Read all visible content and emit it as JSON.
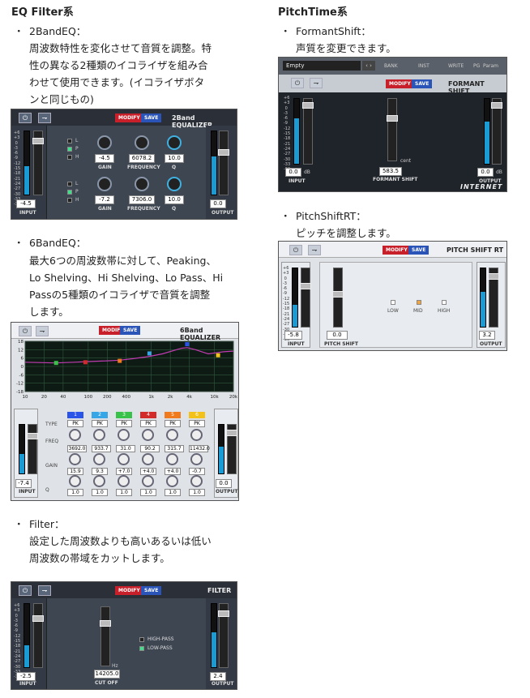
{
  "sections": {
    "eq": {
      "heading": "EQ Filter系",
      "items": [
        {
          "name": "2BandEQ：",
          "lines": [
            "周波数特性を変化させて音質を調整。特",
            "性の異なる2種類のイコライザを組み合",
            "わせて使用できます。(イコライザボタ",
            "ンと同じもの)"
          ]
        },
        {
          "name": "6BandEQ：",
          "lines": [
            "最大6つの周波数帯に対して、Peaking、",
            "Lo Shelving、Hi Shelving、Lo Pass、Hi",
            "Passの5種類のイコライザで音質を調整",
            "します。"
          ]
        },
        {
          "name": "Filter：",
          "lines": [
            "設定した周波数よりも高いあるいは低い",
            "周波数の帯域をカットします。"
          ]
        }
      ]
    },
    "pitch": {
      "heading": "PitchTime系",
      "items": [
        {
          "name": "FormantShift：",
          "lines": [
            "声質を変更できます。"
          ]
        },
        {
          "name": "PitchShiftRT：",
          "lines": [
            "ピッチを調整します。"
          ]
        }
      ]
    }
  },
  "common": {
    "modify": "MODIFY",
    "save": "SAVE",
    "input": "INPUT",
    "output": "OUTPUT",
    "power": "⏻",
    "route": "⇁",
    "db": "dB"
  },
  "band2": {
    "title": "2Band EQUALIZER",
    "in": "-4.5",
    "out": "0.0",
    "rows": [
      {
        "gain": "-4.5",
        "freq": "6078.2",
        "q": "10.0",
        "checks": [
          "L",
          "P",
          "H"
        ]
      },
      {
        "gain": "-7.2",
        "freq": "7306.0",
        "q": "10.0",
        "checks": [
          "L",
          "P",
          "H"
        ]
      }
    ],
    "gain_l": "GAIN",
    "freq_l": "FREQUENCY",
    "q_l": "Q",
    "hz": "Hz"
  },
  "band6": {
    "title": "6Band EQUALIZER",
    "in": "-7.4",
    "out": "0.0",
    "yticks": [
      "18",
      "12",
      "6",
      "0",
      "-6",
      "-12",
      "-18"
    ],
    "xticks": [
      "10",
      "20",
      "40",
      "100",
      "200",
      "400",
      "1k",
      "2k",
      "4k",
      "10k",
      "20k"
    ],
    "bands": [
      "1",
      "2",
      "3",
      "4",
      "5",
      "6"
    ],
    "band_colors": [
      "#2a54e8",
      "#37a6e6",
      "#39c24a",
      "#d32a2a",
      "#f07a1e",
      "#f2c21b"
    ],
    "type_l": "TYPE",
    "freq_l": "FREQ",
    "gain_l": "GAIN",
    "q_l": "Q",
    "types": [
      "PK",
      "PK",
      "PK",
      "PK",
      "PK",
      "PK"
    ],
    "freqs": [
      "3692.0",
      "933.7",
      "31.0",
      "90.2",
      "315.7",
      "11432.0"
    ],
    "gains": [
      "15.9",
      "9.3",
      "+7.0",
      "+4.0",
      "+4.0",
      "-0.7"
    ],
    "qs": [
      "1.0",
      "1.0",
      "1.0",
      "1.0",
      "1.0",
      "1.0"
    ]
  },
  "filter": {
    "title": "FILTER",
    "in": "-2.5",
    "out": "2.4",
    "cutoff": "14205.0",
    "cutoff_l": "CUT OFF",
    "hz": "Hz",
    "hp": "HIGH-PASS",
    "lp": "LOW-PASS"
  },
  "formant": {
    "preset": "Empty",
    "bank": "BANK",
    "inst": "INST",
    "write": "WRITE",
    "pg": "PG",
    "param": "Param",
    "title": "FORMANT SHIFT",
    "in": "0.0",
    "out": "0.0",
    "shift": "583.5",
    "cent": "cent",
    "shift_l": "FORMANT SHIFT",
    "logo": "INTERNET"
  },
  "pitchrt": {
    "title": "PITCH SHIFT RT",
    "in": "-5.8",
    "out": "3.2",
    "pitch": "0.0",
    "pitch_l": "PITCH SHIFT",
    "low": "LOW",
    "mid": "MID",
    "high": "HIGH"
  },
  "scale": "+6\n+3\n 0\n-3\n-6\n-9\n-12\n-15\n-18\n-21\n-24\n-27\n-30\n-33\n-36",
  "chart_data": {
    "type": "line",
    "x_scale": "log",
    "xlim": [
      10,
      20000
    ],
    "ylim": [
      -18,
      18
    ],
    "ylabel": "dB",
    "x": [
      10,
      30,
      60,
      100,
      200,
      315,
      500,
      900,
      1500,
      3000,
      3692,
      5000,
      8000,
      11432,
      14000,
      20000
    ],
    "series": [
      {
        "values": [
          3,
          2.5,
          3,
          3.5,
          4,
          4.5,
          5.5,
          7,
          9,
          13,
          13.5,
          12,
          9,
          10,
          10.5,
          11
        ]
      }
    ],
    "points": [
      {
        "x": 31,
        "y": 2.5
      },
      {
        "x": 90.2,
        "y": 3
      },
      {
        "x": 315.7,
        "y": 4
      },
      {
        "x": 933.7,
        "y": 9.3
      },
      {
        "x": 3692,
        "y": 15.9
      },
      {
        "x": 11432,
        "y": 8
      }
    ]
  }
}
